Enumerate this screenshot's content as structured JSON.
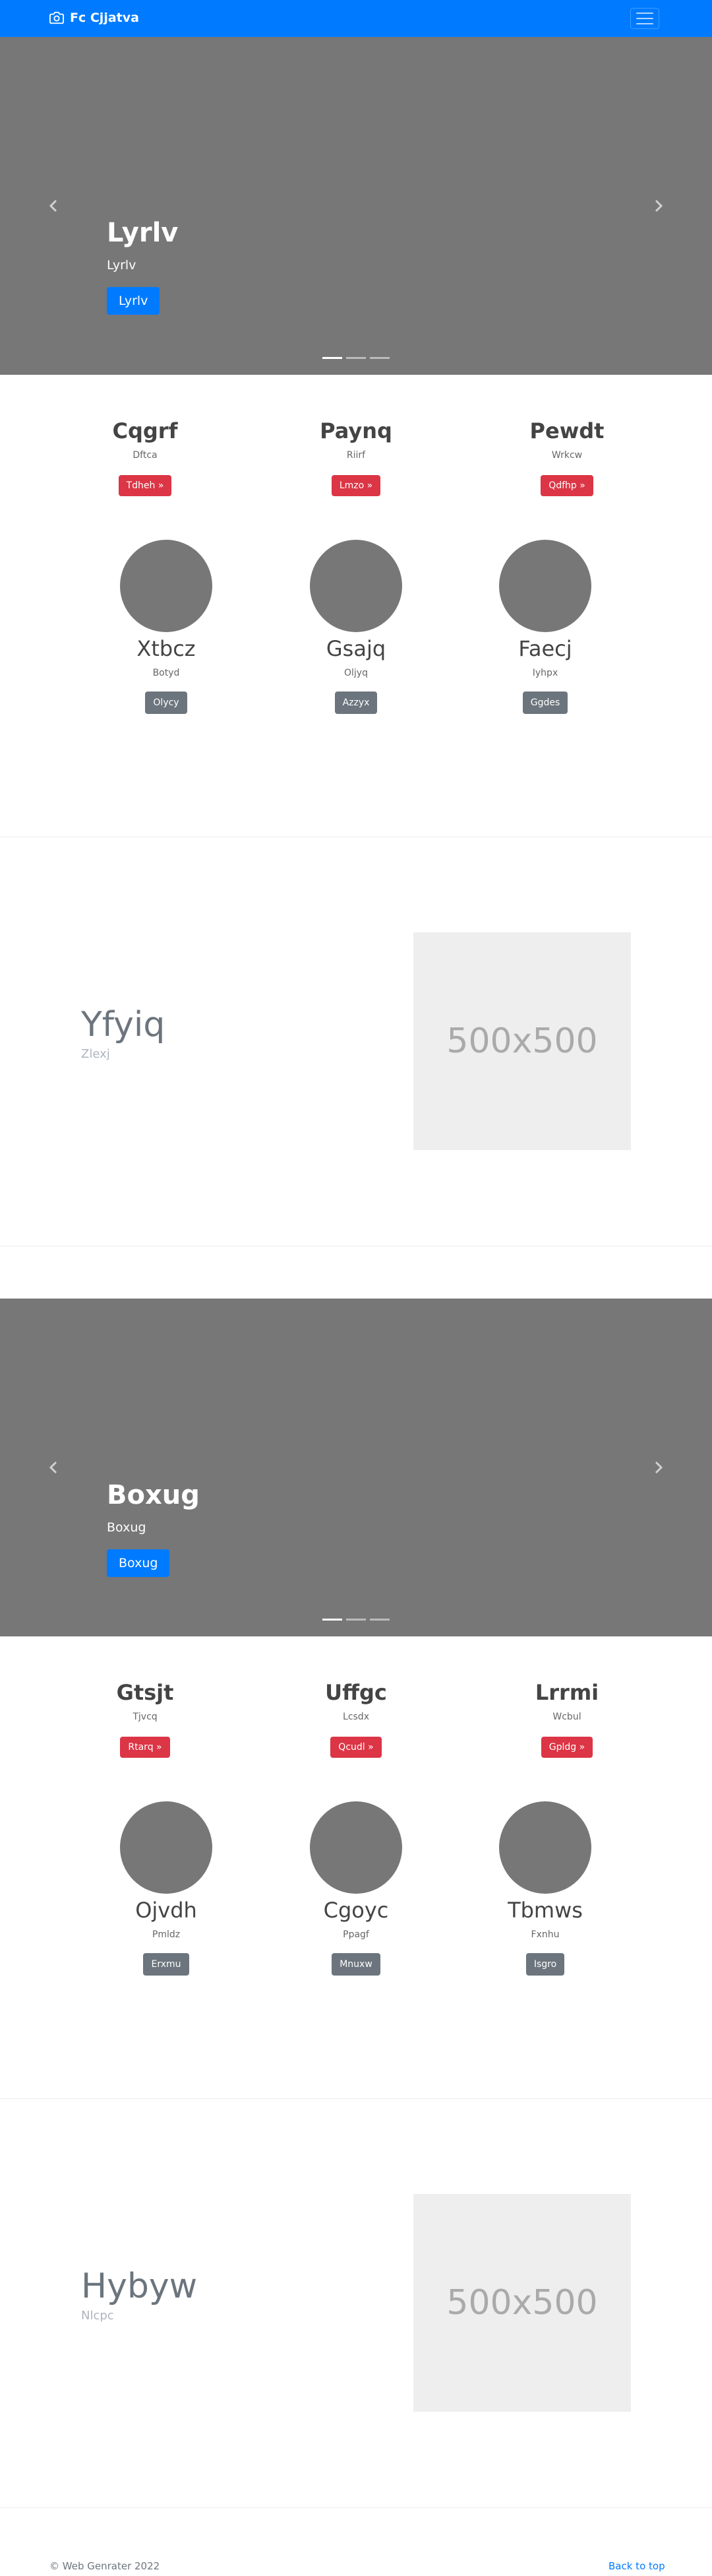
{
  "navbar": {
    "brand": "Fc Cjjatva",
    "accent": "#007bff",
    "brand_icon": "camera-icon",
    "toggler_icon": "hamburger-icon"
  },
  "carousel1": {
    "title": "Lyrlv",
    "text": "Lyrlv",
    "button": "Lyrlv"
  },
  "row1": {
    "cols": [
      {
        "heading": "Cqgrf",
        "text": "Dftca",
        "button": "Tdheh »"
      },
      {
        "heading": "Paynq",
        "text": "Riirf",
        "button": "Lmzo »"
      },
      {
        "heading": "Pewdt",
        "text": "Wrkcw",
        "button": "Qdfhp »"
      }
    ],
    "circles": [
      {
        "heading": "Xtbcz",
        "text": "Botyd",
        "button": "Olycy"
      },
      {
        "heading": "Gsajq",
        "text": "Oljyq",
        "button": "Azzyx"
      },
      {
        "heading": "Faecj",
        "text": "Iyhpx",
        "button": "Ggdes"
      }
    ]
  },
  "feature1": {
    "title": "Yfyiq",
    "subtitle": "Zlexj",
    "image_label": "500x500"
  },
  "carousel2": {
    "title": "Boxug",
    "text": "Boxug",
    "button": "Boxug"
  },
  "row2": {
    "cols": [
      {
        "heading": "Gtsjt",
        "text": "Tjvcq",
        "button": "Rtarq »"
      },
      {
        "heading": "Uffgc",
        "text": "Lcsdx",
        "button": "Qcudl »"
      },
      {
        "heading": "Lrrmi",
        "text": "Wcbul",
        "button": "Gpldg »"
      }
    ],
    "circles": [
      {
        "heading": "Ojvdh",
        "text": "Pmldz",
        "button": "Erxmu"
      },
      {
        "heading": "Cgoyc",
        "text": "Ppagf",
        "button": "Mnuxw"
      },
      {
        "heading": "Tbmws",
        "text": "Fxnhu",
        "button": "Isgro"
      }
    ]
  },
  "feature2": {
    "title": "Hybyw",
    "subtitle": "Nlcpc",
    "image_label": "500x500"
  },
  "footer": {
    "copyright": "© Web Genrater 2022",
    "back_to_top": "Back to top"
  }
}
